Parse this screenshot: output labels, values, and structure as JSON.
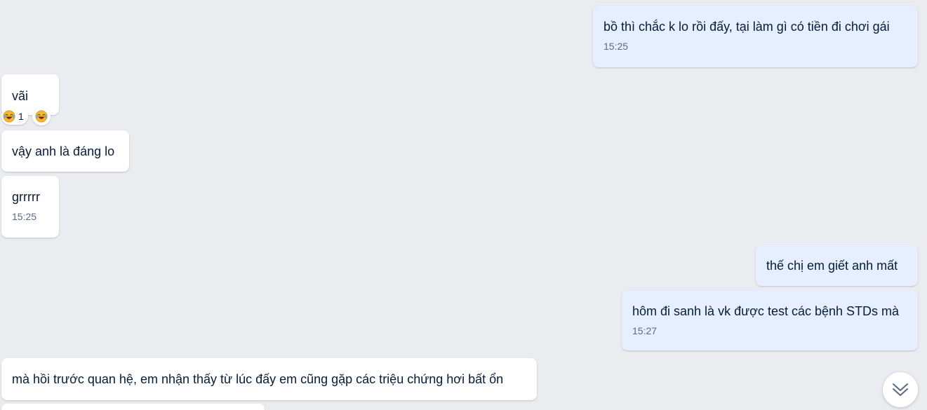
{
  "messages": [
    {
      "text": "bồ thì chắc k lo rồi đấy, tại làm gì có tiền đi chơi gái",
      "time": "15:25"
    },
    {
      "text": "vãi",
      "reaction_count": "1"
    },
    {
      "text": "vậy anh là đáng lo"
    },
    {
      "text": "grrrrr",
      "time": "15:25"
    },
    {
      "text": "thế chị em giết anh mất"
    },
    {
      "text": "hôm đi sanh là vk được test các bệnh STDs mà",
      "time": "15:27"
    },
    {
      "text": "mà hồi trước quan hệ, em nhận thấy từ lúc đấy em cũng gặp các triệu chứng hơi bất ổn"
    }
  ],
  "icons": {
    "reaction": "laughing-crying-emoji-icon",
    "scroll": "double-chevron-down-icon"
  },
  "colors": {
    "background": "#ebecf0",
    "incoming_bubble": "#ffffff",
    "outgoing_bubble": "#e5efff",
    "text": "#081c36",
    "time": "#5a6981"
  }
}
